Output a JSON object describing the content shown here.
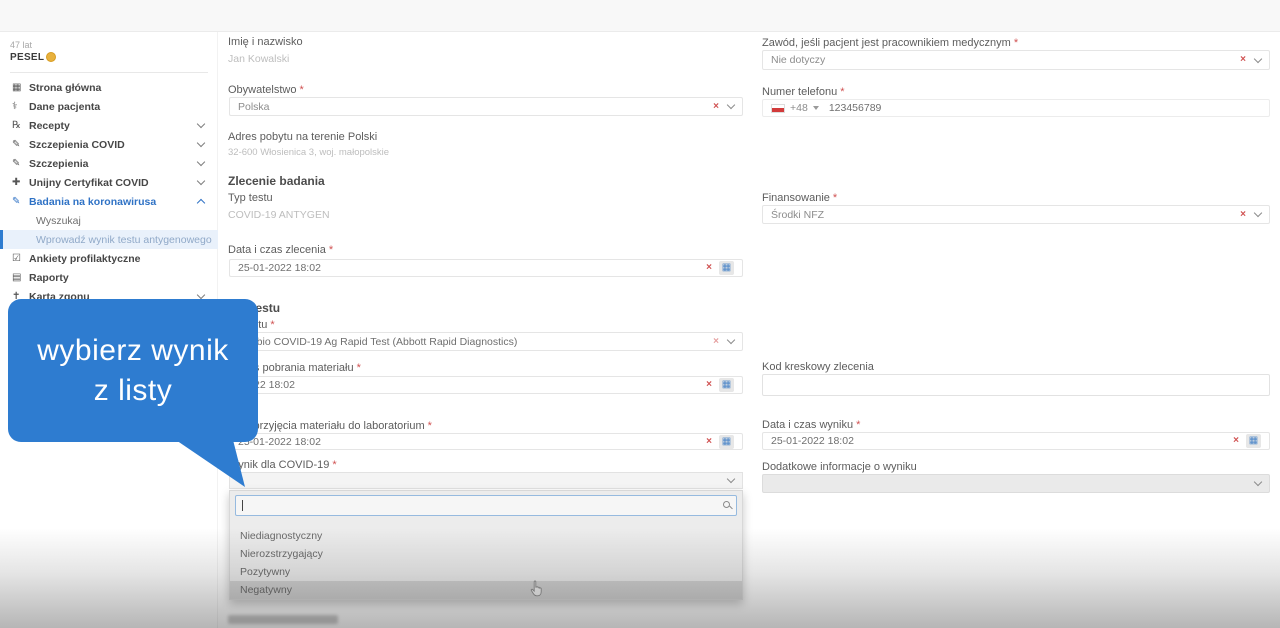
{
  "marks": {
    "required": "*"
  },
  "icons": {
    "clear": "×",
    "calendar": "▦"
  },
  "colors": {
    "accent_blue": "#2e7cd0",
    "sidebar_active_blue": "#2f72c5",
    "required_red": "#d05151",
    "pesel_badge_orange": "#e8b13d",
    "highlight_row_grey": "#d2d2d2"
  },
  "patient": {
    "age": "47 lat",
    "pesel_label": "PESEL"
  },
  "sidebar": {
    "items": [
      {
        "label": "Strona główna",
        "icon_glyph": "▦"
      },
      {
        "label": "Dane pacjenta",
        "icon_glyph": "⚕"
      },
      {
        "label": "Recepty",
        "icon_glyph": "℞"
      },
      {
        "label": "Szczepienia COVID",
        "icon_glyph": "✎"
      },
      {
        "label": "Szczepienia",
        "icon_glyph": "✎"
      },
      {
        "label": "Unijny Certyfikat COVID",
        "icon_glyph": "✚"
      },
      {
        "label": "Badania na koronawirusa",
        "icon_glyph": "✎"
      },
      {
        "label": "Wyszukaj",
        "icon_glyph": ""
      },
      {
        "label": "Wprowadź wynik testu antygenowego",
        "icon_glyph": ""
      },
      {
        "label": "Ankiety profilaktyczne",
        "icon_glyph": "☑"
      },
      {
        "label": "Raporty",
        "icon_glyph": "▤"
      },
      {
        "label": "Karta zgonu",
        "icon_glyph": "✝"
      }
    ]
  },
  "form": {
    "sections": {
      "zlecenie": "Zlecenie badania",
      "wykonanie": "Wykonanie testu"
    },
    "imie": {
      "label": "Imię i nazwisko",
      "value": "Jan Kowalski"
    },
    "zawod": {
      "label": "Zawód, jeśli pacjent jest pracownikiem medycznym",
      "value": "Nie dotyczy"
    },
    "obywatelstwo": {
      "label": "Obywatelstwo",
      "value": "Polska"
    },
    "telefon": {
      "label": "Numer telefonu",
      "prefix": "+48",
      "value": "123456789"
    },
    "adres": {
      "label": "Adres pobytu na terenie Polski",
      "value": "32-600 Włosienica 3, woj. małopolskie"
    },
    "typ_testu": {
      "label": "Typ testu",
      "value": "COVID-19 ANTYGEN"
    },
    "finansowanie": {
      "label": "Finansowanie",
      "value": "Środki NFZ"
    },
    "data_zlecenia": {
      "label": "Data i czas zlecenia",
      "value": "25-01-2022 18:02"
    },
    "producent": {
      "label": "Producent i nazwa testu",
      "value": "Panbio COVID-19 Ag Rapid Test (Abbott Rapid Diagnostics)"
    },
    "data_pobrania": {
      "label": "Data i czas pobrania materiału",
      "value": "25-01-2022 18:02"
    },
    "kod_kreskowy": {
      "label": "Kod kreskowy zlecenia",
      "value": ""
    },
    "data_przyjecia": {
      "label": "Data i czas przyjęcia materiału do laboratorium",
      "value": "25-01-2022 18:02"
    },
    "data_wyniku": {
      "label": "Data i czas wyniku",
      "value": "25-01-2022 18:02"
    },
    "wynik": {
      "label": "Wynik dla COVID-19",
      "search_value": "",
      "options": [
        {
          "label": "Niediagnostyczny"
        },
        {
          "label": "Nierozstrzygający"
        },
        {
          "label": "Pozytywny"
        },
        {
          "label": "Negatywny"
        }
      ],
      "highlighted": "Negatywny"
    },
    "dodatkowe": {
      "label": "Dodatkowe informacje o wyniku"
    }
  },
  "tooltip": {
    "line1": "wybierz wynik",
    "line2": "z listy"
  }
}
